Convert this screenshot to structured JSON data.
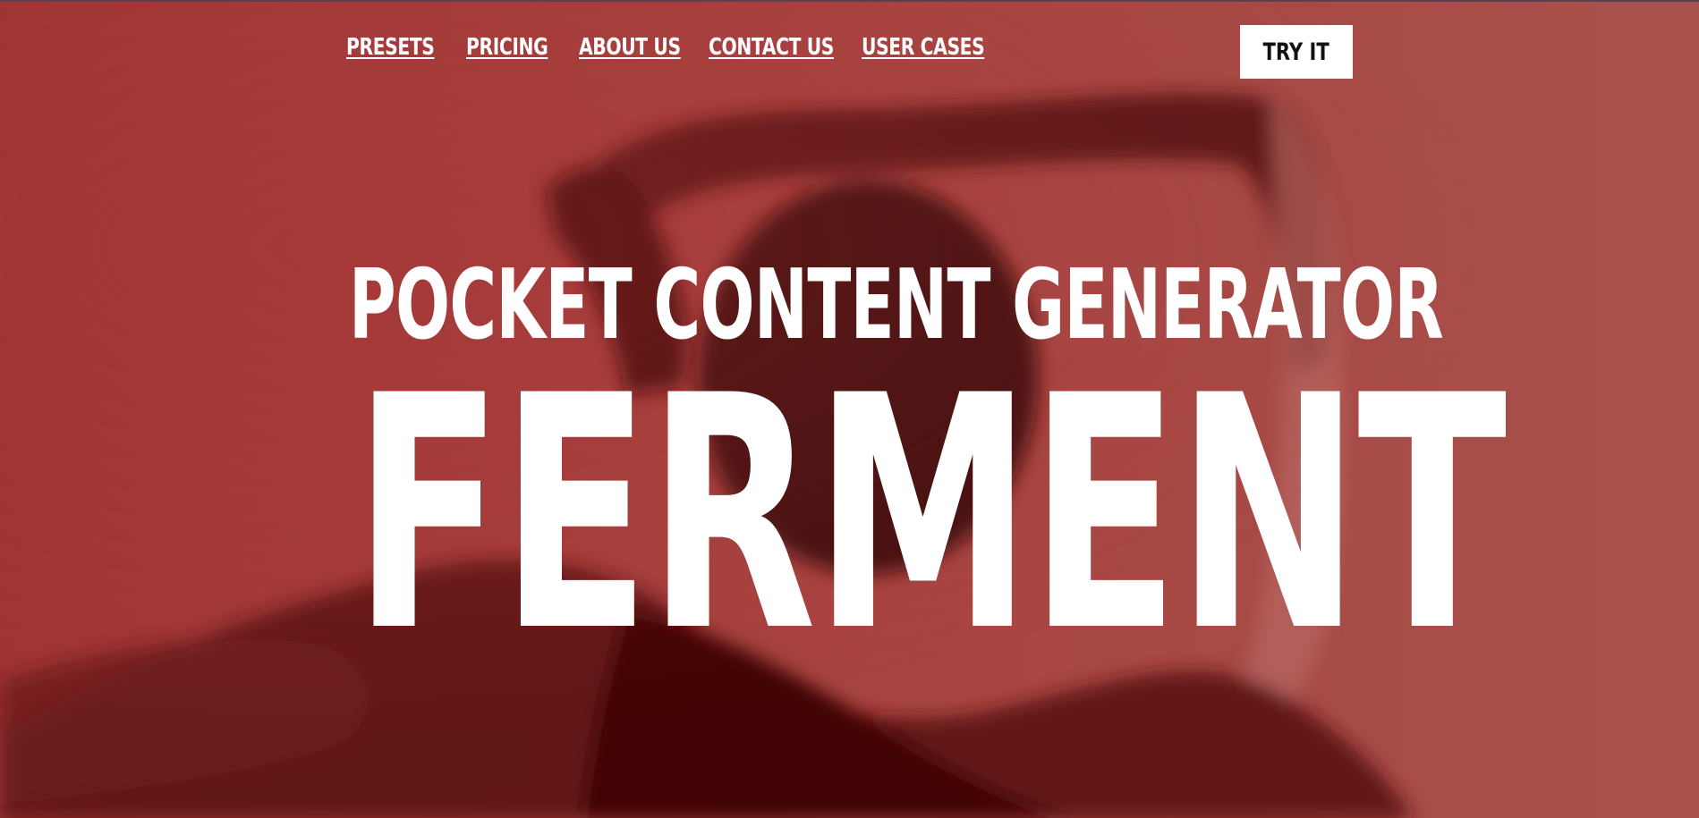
{
  "nav": {
    "items": [
      {
        "label": "PRESETS"
      },
      {
        "label": "PRICING"
      },
      {
        "label": "ABOUT US"
      },
      {
        "label": "CONTACT US"
      },
      {
        "label": "USER CASES"
      }
    ],
    "cta_label": "TRY IT"
  },
  "hero": {
    "subtitle": "POCKET CONTENT GENERATOR",
    "title": "FERMENT"
  },
  "colors": {
    "background_tint": "#a64440",
    "text": "#ffffff",
    "cta_background": "#ffffff",
    "cta_text": "#111111"
  }
}
